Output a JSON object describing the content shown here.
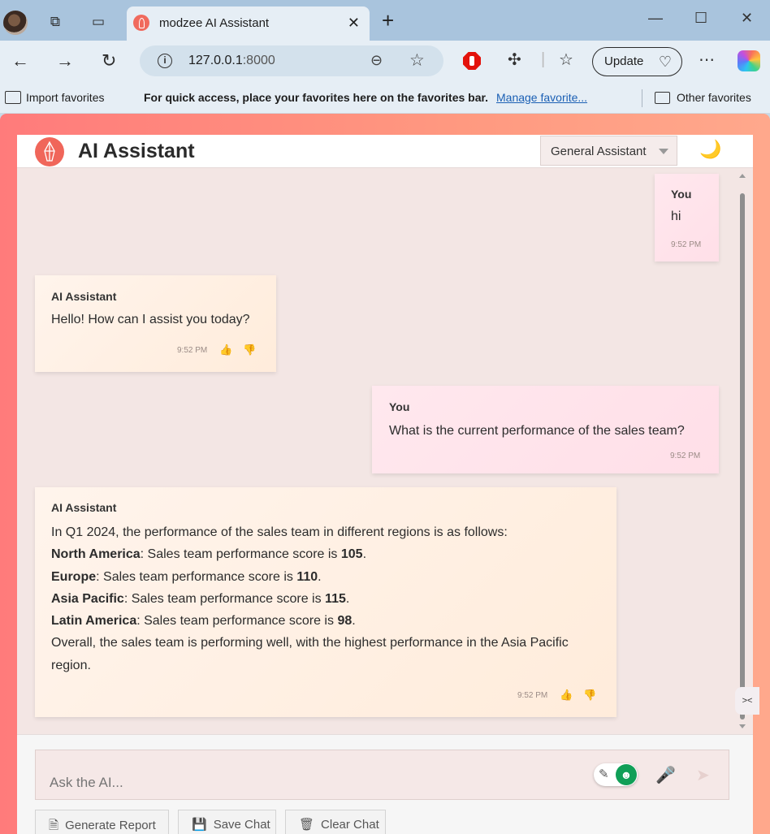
{
  "browser": {
    "tab_title": "modzee AI Assistant",
    "address": {
      "host": "127.0.0.1",
      "port": ":8000"
    },
    "update_label": "Update",
    "favorites": {
      "import_label": "Import favorites",
      "message": "For quick access, place your favorites here on the favorites bar.",
      "manage_link": "Manage favorite...",
      "other_label": "Other favorites"
    },
    "icons": [
      "profile-avatar",
      "workspaces-icon",
      "tab-actions-icon",
      "close-icon",
      "new-tab-icon",
      "minimize-icon",
      "maximize-icon",
      "close-window-icon",
      "back-icon",
      "forward-icon",
      "refresh-icon",
      "info-icon",
      "zoom-icon",
      "favorite-star-icon",
      "adblock-icon",
      "extensions-icon",
      "favorites-icon",
      "more-icon",
      "copilot-icon"
    ]
  },
  "app": {
    "title": "AI Assistant",
    "mode": "General Assistant",
    "theme_icon": "🌙",
    "accent_color": "#f0665a"
  },
  "messages": [
    {
      "role": "user",
      "sender": "You",
      "text": "hi",
      "time": "9:52 PM"
    },
    {
      "role": "ai",
      "sender": "AI Assistant",
      "text": "Hello! How can I assist you today?",
      "time": "9:52 PM"
    },
    {
      "role": "user",
      "sender": "You",
      "text": "What is the current performance of the sales team?",
      "time": "9:52 PM"
    },
    {
      "role": "ai",
      "sender": "AI Assistant",
      "intro": "In Q1 2024, the performance of the sales team in different regions is as follows:",
      "regions": [
        {
          "name": "North America",
          "text": ": Sales team performance score is ",
          "score": "105"
        },
        {
          "name": "Europe",
          "text": ": Sales team performance score is ",
          "score": "110"
        },
        {
          "name": "Asia Pacific",
          "text": ": Sales team performance score is ",
          "score": "115"
        },
        {
          "name": "Latin America",
          "text": ": Sales team performance score is ",
          "score": "98"
        }
      ],
      "summary": "Overall, the sales team is performing well, with the highest performance in the Asia Pacific region.",
      "time": "9:52 PM"
    }
  ],
  "input": {
    "placeholder": "Ask the AI...",
    "buttons": {
      "generate": "Generate Report",
      "save": "Save Chat",
      "clear": "Clear Chat"
    }
  }
}
